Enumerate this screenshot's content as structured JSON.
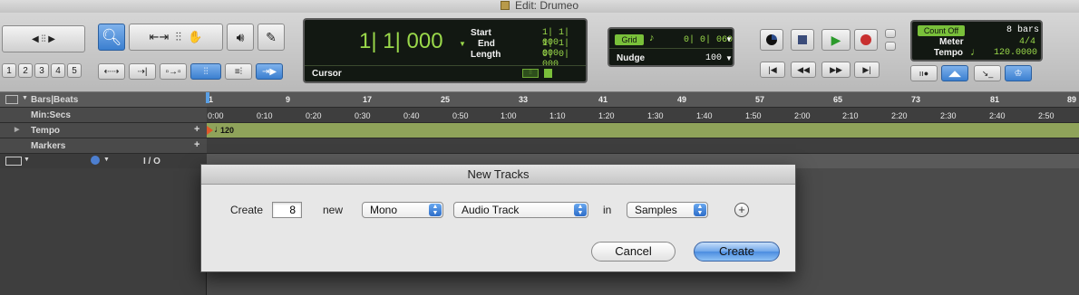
{
  "window": {
    "title": "Edit: Drumeo"
  },
  "toolbar": {
    "zoom_presets": [
      "1",
      "2",
      "3",
      "4",
      "5"
    ],
    "counter": {
      "main": "1| 1| 000",
      "start_label": "Start",
      "start_value": "1| 1| 000",
      "end_label": "End",
      "end_value": "1| 1| 000",
      "length_label": "Length",
      "length_value": "0| 0| 000",
      "cursor_label": "Cursor"
    },
    "grid": {
      "label": "Grid",
      "value": "0| 0| 060",
      "nudge_label": "Nudge",
      "nudge_value": "100"
    },
    "count_off": {
      "label": "Count Off",
      "bars": "8 bars",
      "meter_label": "Meter",
      "meter_value": "4/4",
      "tempo_label": "Tempo",
      "tempo_value": "120.0000"
    }
  },
  "rulers": {
    "bars_label": "Bars|Beats",
    "bars_ticks": [
      "1",
      "9",
      "17",
      "25",
      "33",
      "41",
      "49",
      "57",
      "65",
      "73",
      "81",
      "89"
    ],
    "minsecs_label": "Min:Secs",
    "minsecs_ticks": [
      "0:00",
      "0:10",
      "0:20",
      "0:30",
      "0:40",
      "0:50",
      "1:00",
      "1:10",
      "1:20",
      "1:30",
      "1:40",
      "1:50",
      "2:00",
      "2:10",
      "2:20",
      "2:30",
      "2:40",
      "2:50"
    ],
    "tempo_label": "Tempo",
    "tempo_marker": "120",
    "markers_label": "Markers",
    "io_label": "I / O"
  },
  "dialog": {
    "title": "New Tracks",
    "create_label": "Create",
    "count_value": "8",
    "new_label": "new",
    "channel_format": "Mono",
    "track_type": "Audio Track",
    "in_label": "in",
    "timebase": "Samples",
    "cancel_label": "Cancel",
    "create_button_label": "Create"
  }
}
